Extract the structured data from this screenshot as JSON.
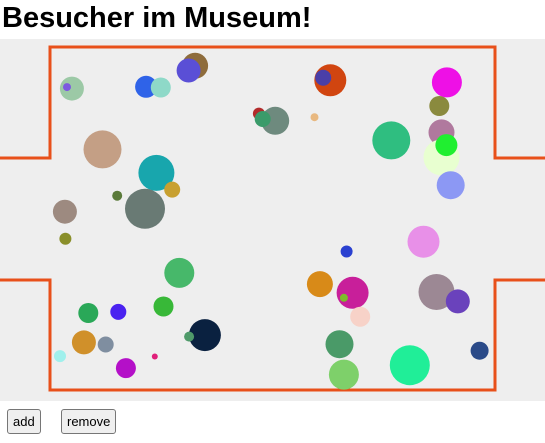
{
  "page": {
    "title": "Besucher im Museum!"
  },
  "colors": {
    "wall": "#e8501a",
    "floor": "#eeeeee"
  },
  "controls": {
    "add_label": "add",
    "remove_label": "remove"
  },
  "visitors": [
    [
      "#8e6c3c",
      0.358,
      0.074,
      13
    ],
    [
      "#5a4fd6",
      0.346,
      0.087,
      12
    ],
    [
      "#d14510",
      0.606,
      0.114,
      16
    ],
    [
      "#4a3fa8",
      0.593,
      0.107,
      8
    ],
    [
      "#9cc9a6",
      0.132,
      0.137,
      12
    ],
    [
      "#7d5ae0",
      0.123,
      0.133,
      4
    ],
    [
      "#2f63e8",
      0.268,
      0.132,
      11
    ],
    [
      "#8ed9c8",
      0.295,
      0.134,
      10
    ],
    [
      "#ee10e6",
      0.82,
      0.12,
      15
    ],
    [
      "#8a8a3e",
      0.806,
      0.185,
      10
    ],
    [
      "#b22b2b",
      0.475,
      0.206,
      6
    ],
    [
      "#6e8a7e",
      0.505,
      0.226,
      14
    ],
    [
      "#3a9b6a",
      0.482,
      0.221,
      8
    ],
    [
      "#e8b880",
      0.577,
      0.216,
      4
    ],
    [
      "#2fbe80",
      0.718,
      0.28,
      19
    ],
    [
      "#b0799e",
      0.81,
      0.258,
      13
    ],
    [
      "#e8ffd0",
      0.81,
      0.327,
      18
    ],
    [
      "#20ef30",
      0.819,
      0.293,
      11
    ],
    [
      "#c49f85",
      0.188,
      0.305,
      19
    ],
    [
      "#18a6ad",
      0.287,
      0.37,
      18
    ],
    [
      "#c8a030",
      0.316,
      0.416,
      8
    ],
    [
      "#5a7a3a",
      0.215,
      0.433,
      5
    ],
    [
      "#697a74",
      0.266,
      0.469,
      20
    ],
    [
      "#9d8a80",
      0.119,
      0.477,
      12
    ],
    [
      "#8a8f2a",
      0.12,
      0.552,
      6
    ],
    [
      "#8c98f4",
      0.827,
      0.404,
      14
    ],
    [
      "#e890e8",
      0.777,
      0.56,
      16
    ],
    [
      "#2a40d0",
      0.636,
      0.587,
      6
    ],
    [
      "#d88a18",
      0.587,
      0.677,
      13
    ],
    [
      "#c81f9a",
      0.647,
      0.701,
      16
    ],
    [
      "#7dba2a",
      0.631,
      0.715,
      4
    ],
    [
      "#9c8894",
      0.801,
      0.699,
      18
    ],
    [
      "#6a42bc",
      0.84,
      0.725,
      12
    ],
    [
      "#f7d2c8",
      0.661,
      0.767,
      10
    ],
    [
      "#47b86a",
      0.329,
      0.646,
      15
    ],
    [
      "#38b838",
      0.3,
      0.739,
      10
    ],
    [
      "#2aa858",
      0.162,
      0.757,
      10
    ],
    [
      "#4a22f0",
      0.217,
      0.754,
      8
    ],
    [
      "#0a2140",
      0.376,
      0.818,
      16
    ],
    [
      "#4f9a6a",
      0.347,
      0.822,
      5
    ],
    [
      "#d0902a",
      0.154,
      0.838,
      12
    ],
    [
      "#7f8ea0",
      0.194,
      0.844,
      8
    ],
    [
      "#a0f0ec",
      0.11,
      0.876,
      6
    ],
    [
      "#e0207a",
      0.284,
      0.877,
      3
    ],
    [
      "#b410c8",
      0.231,
      0.909,
      10
    ],
    [
      "#4a9a68",
      0.623,
      0.843,
      14
    ],
    [
      "#7ed06a",
      0.631,
      0.927,
      15
    ],
    [
      "#20ee98",
      0.752,
      0.901,
      20
    ],
    [
      "#2a4a88",
      0.88,
      0.861,
      9
    ]
  ]
}
